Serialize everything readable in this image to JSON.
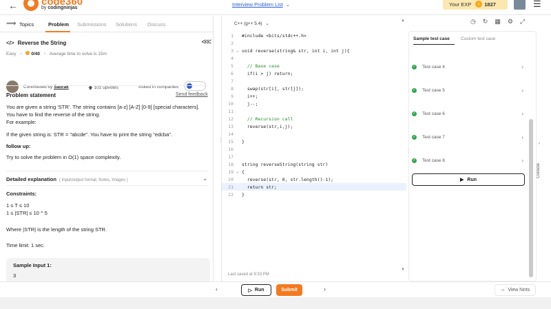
{
  "header": {
    "brand": "code360",
    "brand_sub_prefix": "by ",
    "brand_sub_bold": "codingninjas",
    "list_link": "Interview Problem List",
    "exp_label": "Your EXP",
    "exp_value": "1827"
  },
  "left": {
    "tabs": [
      {
        "label": "Topics"
      },
      {
        "label": "Problem"
      },
      {
        "label": "Submissions"
      },
      {
        "label": "Solutions"
      },
      {
        "label": "Discuss"
      }
    ],
    "title": "Reverse the String",
    "difficulty": "Easy",
    "score": "0/40",
    "avg_time": "Average time to solve is 15m",
    "contributed_prefix": "Contributed by ",
    "contributor": "Saurak",
    "upvotes": "102 upvotes",
    "asked_in": "Asked in companies",
    "statement_title": "Problem statement",
    "feedback": "Send feedback",
    "para1": "You are given a string 'STR'. The string contains [a-z] [A-Z] [0-9] [special characters]. You have to find the reverse of the string.",
    "para2": "For example:",
    "example": " If the given string is: STR = \"abcde\". You have to print the string \"edcba\".",
    "follow_title": "follow up:",
    "follow_text": "Try to solve the problem in O(1) space complexity.",
    "details_title": "Detailed explanation",
    "details_sub": "( Input/output format, Notes, Images )",
    "constraints_title": "Constraints:",
    "constraint1": "1 ≤ T ≤ 10",
    "constraint2": "1 ≤ |STR| ≤ 10 ^ 5",
    "where_text": "Where |STR| is the length of the string STR.",
    "time_limit": "Time limit: 1 sec.",
    "sample_title": "Sample Input 1:",
    "sample_val": "3"
  },
  "editor": {
    "language": "C++ (g++ 5.4)",
    "saved": "Last saved at 9:33 PM",
    "lines": [
      {
        "n": "1",
        "t": "#include <bits/stdc++.h>"
      },
      {
        "n": "2",
        "t": ""
      },
      {
        "n": "3",
        "t": "void reverse(string& str, int i, int j){"
      },
      {
        "n": "4",
        "t": ""
      },
      {
        "n": "5",
        "t": "  // Base case"
      },
      {
        "n": "6",
        "t": "  if(i > j) return;"
      },
      {
        "n": "7",
        "t": ""
      },
      {
        "n": "8",
        "t": "  swap(str[i], str[j]);"
      },
      {
        "n": "9",
        "t": "  i++;"
      },
      {
        "n": "10",
        "t": "  j--;"
      },
      {
        "n": "11",
        "t": ""
      },
      {
        "n": "12",
        "t": "  // Recursion call"
      },
      {
        "n": "13",
        "t": "  reverse(str,i,j);"
      },
      {
        "n": "14",
        "t": ""
      },
      {
        "n": "15",
        "t": "}"
      },
      {
        "n": "16",
        "t": ""
      },
      {
        "n": "17",
        "t": ""
      },
      {
        "n": "18",
        "t": "string reverseString(string str)"
      },
      {
        "n": "19",
        "t": "{"
      },
      {
        "n": "20",
        "t": "  reverse(str, 0, str.length()-1);"
      },
      {
        "n": "21",
        "t": "  return str;"
      },
      {
        "n": "22",
        "t": "}"
      }
    ]
  },
  "right": {
    "tab_sample": "Sample test case",
    "tab_custom": "Custom test case",
    "test_cases": [
      "Test case 4",
      "Test case 5",
      "Test case 6",
      "Test case 7",
      "Test case 8"
    ],
    "run": "Run",
    "console": "Console"
  },
  "bottom": {
    "run": "Run",
    "submit": "Submit",
    "hints": "View hints"
  },
  "colors": {
    "accent": "#f47a20",
    "pass": "#2fa84f",
    "link": "#2a5bd7"
  }
}
